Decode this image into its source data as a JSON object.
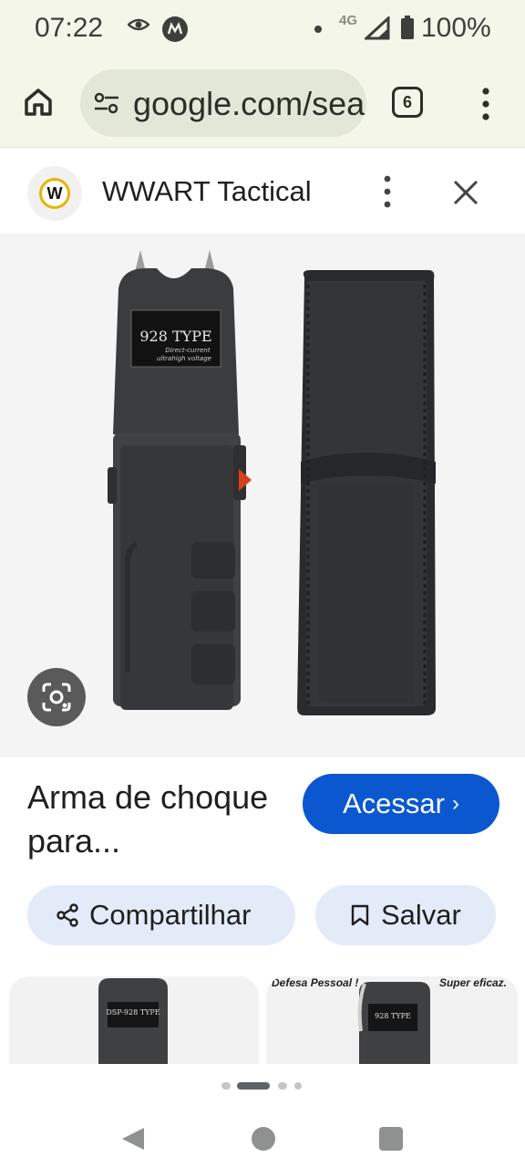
{
  "status_bar": {
    "time": "07:22",
    "network": "4G",
    "battery": "100%",
    "icons": [
      "eye-icon",
      "motorola-icon",
      "notification-dot-icon",
      "signal-icon",
      "battery-icon"
    ]
  },
  "browser": {
    "url": "google.com/search?",
    "tab_count": "6",
    "icons": [
      "home-icon",
      "tune-icon",
      "tabs-icon",
      "more-vert-icon"
    ]
  },
  "result": {
    "site_name": "WWART Tactical",
    "site_logo_letter": "W",
    "title": "Arma de choque para...",
    "visit_label": "Acessar",
    "visit_chevron": "›",
    "share_label": "Compartilhar",
    "save_label": "Salvar",
    "image": {
      "device_label": "928 TYPE",
      "device_sublabel_1": "Direct-current",
      "device_sublabel_2": "ultrahigh voltage"
    }
  },
  "related": {
    "thumb_1_label": "DSP-928 TYPE",
    "thumb_2_caption_left": "Defesa Pessoal !",
    "thumb_2_caption_right": "Super eficaz.",
    "thumb_2_label": "928 TYPE"
  },
  "colors": {
    "accent": "#0b57d0",
    "chip_bg": "#e3ebf9",
    "browser_bg": "#f3f6e9",
    "url_pill_bg": "#e2e7d8"
  },
  "pager": {
    "active_index": 1,
    "count": 4
  }
}
